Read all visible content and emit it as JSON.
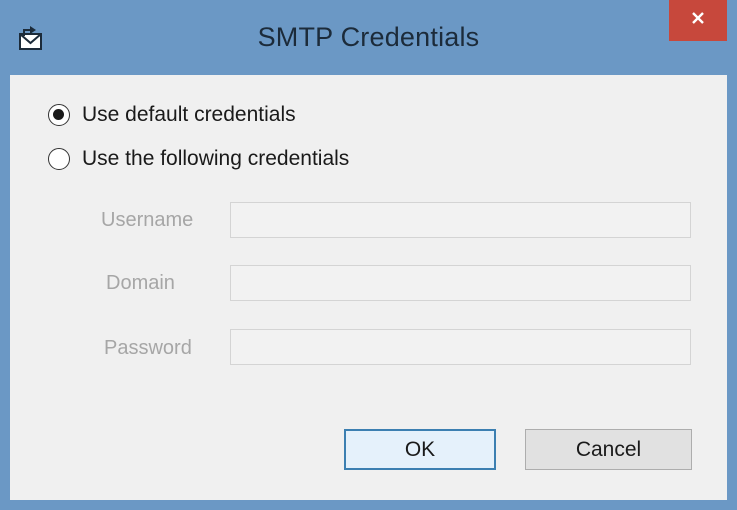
{
  "window": {
    "title": "SMTP Credentials"
  },
  "icons": {
    "app": "envelope-arrow-icon",
    "close": "close-icon"
  },
  "options": [
    {
      "label": "Use default credentials",
      "selected": true
    },
    {
      "label": "Use the following credentials",
      "selected": false
    }
  ],
  "fields": {
    "username": {
      "label": "Username",
      "value": ""
    },
    "domain": {
      "label": "Domain",
      "value": ""
    },
    "password": {
      "label": "Password",
      "value": ""
    }
  },
  "buttons": {
    "ok": "OK",
    "cancel": "Cancel"
  },
  "colors": {
    "titlebar": "#6b98c5",
    "close": "#c7483c",
    "client": "#f0f0f0",
    "disabled_text": "#a6a6a6",
    "default_button_border": "#3c7fb1"
  }
}
